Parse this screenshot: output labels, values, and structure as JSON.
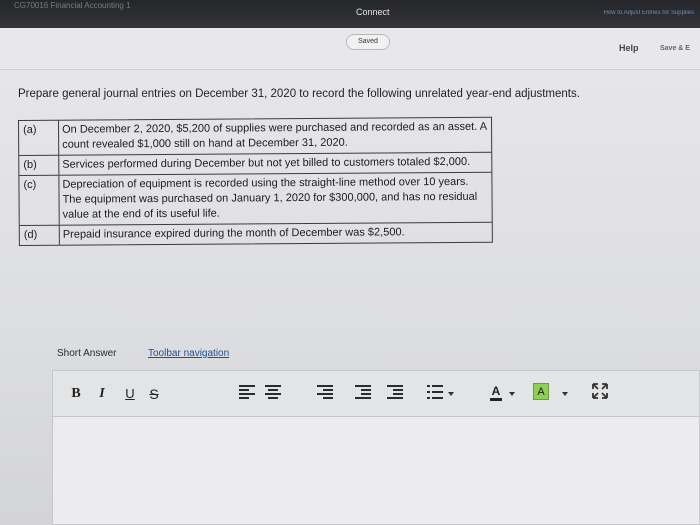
{
  "topbar": {
    "course_title": "CG70016 Financial Accounting 1",
    "center_label": "Connect",
    "right_link": "How to Adjust Entries for Supplies"
  },
  "header": {
    "saved_status": "Saved",
    "help_label": "Help",
    "save_exit_label": "Save & E"
  },
  "question": {
    "prompt": "Prepare general journal entries on December 31, 2020 to record the following unrelated year-end adjustments.",
    "adjustments": [
      {
        "letter": "(a)",
        "text": "On December 2, 2020, $5,200 of supplies were purchased and recorded as an asset. A count revealed $1,000 still on hand at December 31, 2020."
      },
      {
        "letter": "(b)",
        "text": "Services performed during December but not yet billed to customers totaled $2,000."
      },
      {
        "letter": "(c)",
        "text": "Depreciation of equipment is recorded using the straight-line method over 10 years. The equipment was purchased on January 1, 2020 for $300,000, and has no residual value at the end of its useful life."
      },
      {
        "letter": "(d)",
        "text": "Prepaid insurance expired during the month of December was $2,500."
      }
    ]
  },
  "answer": {
    "label": "Short Answer",
    "toolbar_nav_link": "Toolbar navigation",
    "toolbar": {
      "bold": "B",
      "italic": "I",
      "underline": "U",
      "strikethrough": "S",
      "text_color": "A",
      "bg_color": "A",
      "bg_color_value": "#8fcf55",
      "icons": [
        "align-left-icon",
        "align-center-icon",
        "align-right-icon",
        "indent-icon",
        "outdent-icon",
        "bullet-list-icon",
        "expand-icon"
      ]
    },
    "editor_value": ""
  }
}
